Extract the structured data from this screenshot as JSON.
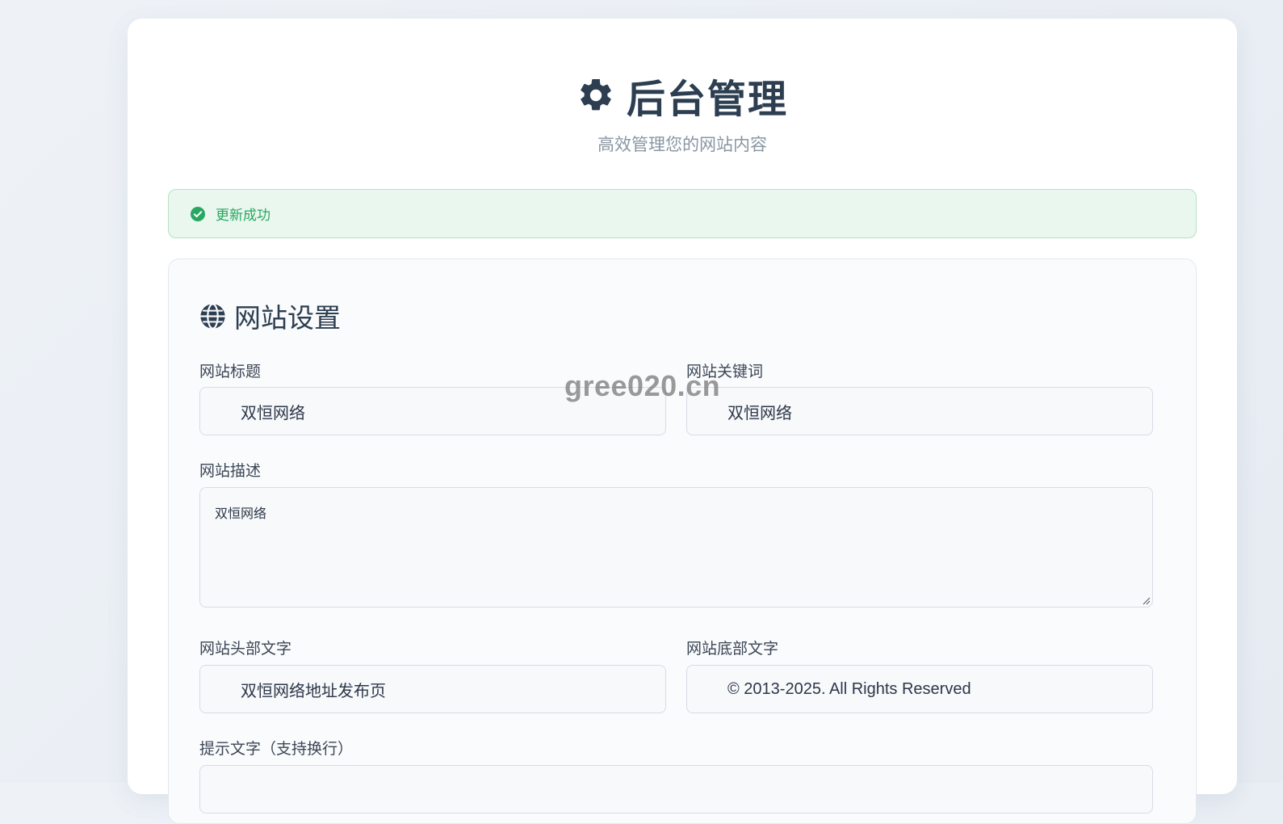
{
  "header": {
    "title": "后台管理",
    "subtitle": "高效管理您的网站内容",
    "icon": "gear-icon"
  },
  "alert": {
    "text": "更新成功",
    "icon": "check-circle-icon",
    "color": "#28a760"
  },
  "settings": {
    "section_title": "网站设置",
    "section_icon": "globe-icon",
    "fields": {
      "site_title": {
        "label": "网站标题",
        "value": "双恒网络"
      },
      "site_keywords": {
        "label": "网站关键词",
        "value": "双恒网络"
      },
      "site_description": {
        "label": "网站描述",
        "value": "双恒网络"
      },
      "header_text": {
        "label": "网站头部文字",
        "value": "双恒网络地址发布页"
      },
      "footer_text": {
        "label": "网站底部文字",
        "value": "© 2013-2025. All Rights Reserved"
      },
      "tip_text": {
        "label": "提示文字（支持换行）",
        "value": ""
      }
    }
  },
  "watermark": "gree020.cn"
}
